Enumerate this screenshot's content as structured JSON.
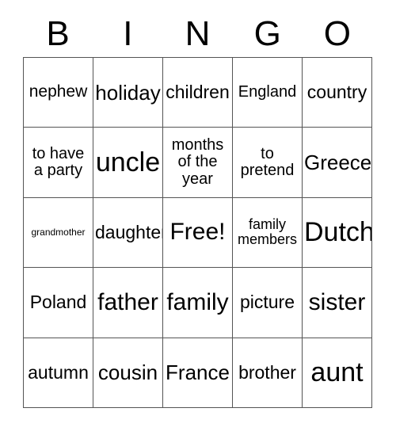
{
  "card": {
    "title": "BINGO",
    "header_letters": [
      "B",
      "I",
      "N",
      "G",
      "O"
    ],
    "free_space": "Free!",
    "border_color": "#555555",
    "text_color": "#000000",
    "background_color": "#ffffff",
    "rows": [
      [
        {
          "text": "nephew",
          "size": "fs-sm"
        },
        {
          "text": "holiday",
          "size": "fs-lg"
        },
        {
          "text": "children",
          "size": "fs-md"
        },
        {
          "text": "England",
          "size": "fs-xs"
        },
        {
          "text": "country",
          "size": "fs-md"
        }
      ],
      [
        {
          "text": "to have\na party",
          "size": "fs-xs"
        },
        {
          "text": "uncle",
          "size": "fs-xxl"
        },
        {
          "text": "months\nof the\nyear",
          "size": "fs-xs"
        },
        {
          "text": "to\npretend",
          "size": "fs-xs"
        },
        {
          "text": "Greece",
          "size": "fs-lg"
        }
      ],
      [
        {
          "text": "grandmother",
          "size": "fs-tiny"
        },
        {
          "text": "daughter",
          "size": "fs-md"
        },
        {
          "text": "Free!",
          "size": "fs-xl"
        },
        {
          "text": "family\nmembers",
          "size": "fs-xxs"
        },
        {
          "text": "Dutch",
          "size": "fs-xxl"
        }
      ],
      [
        {
          "text": "Poland",
          "size": "fs-md"
        },
        {
          "text": "father",
          "size": "fs-xl"
        },
        {
          "text": "family",
          "size": "fs-xl"
        },
        {
          "text": "picture",
          "size": "fs-md"
        },
        {
          "text": "sister",
          "size": "fs-xl"
        }
      ],
      [
        {
          "text": "autumn",
          "size": "fs-md"
        },
        {
          "text": "cousin",
          "size": "fs-lg"
        },
        {
          "text": "France",
          "size": "fs-lg"
        },
        {
          "text": "brother",
          "size": "fs-md"
        },
        {
          "text": "aunt",
          "size": "fs-xxl"
        }
      ]
    ]
  }
}
